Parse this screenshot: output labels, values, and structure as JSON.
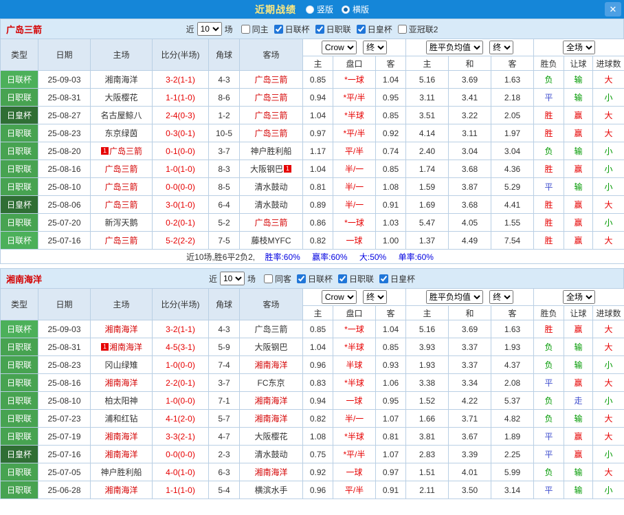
{
  "titlebar": {
    "title": "近期战绩",
    "radio_vertical": "竖版",
    "radio_horizontal": "横版",
    "selected_layout": "横版",
    "close": "✕"
  },
  "colors": {
    "topbar_blue": "#1586d8",
    "title_yellow": "#ffe97f",
    "section_bar_blue": "#d8eaf8",
    "header_blue": "#dce8f4",
    "team_red": "#d40000",
    "result_red": "#e60000",
    "result_green": "#009900",
    "result_blue": "#4150cf",
    "stat_blue": "#0000e0"
  },
  "type_colors": {
    "日联杯": "#4cb05a",
    "日职联": "#47a351",
    "日皇杯": "#2f6e34"
  },
  "sections": [
    {
      "team": "广岛三箭",
      "filter": {
        "near": "近",
        "count": "10",
        "games": "场",
        "checkboxes": [
          {
            "label": "同主",
            "checked": false
          },
          {
            "label": "日联杯",
            "checked": true
          },
          {
            "label": "日职联",
            "checked": true
          },
          {
            "label": "日皇杯",
            "checked": true
          },
          {
            "label": "亚冠联2",
            "checked": false
          }
        ]
      },
      "header": {
        "type": "类型",
        "date": "日期",
        "home": "主场",
        "score": "比分(半场)",
        "corner": "角球",
        "away": "客场",
        "book": "Crow",
        "fin1": "终",
        "euro": "胜平负均值",
        "fin2": "终",
        "scope": "全场",
        "sub": [
          "主",
          "盘口",
          "客",
          "主",
          "和",
          "客",
          "胜负",
          "让球",
          "进球数"
        ]
      },
      "rows": [
        {
          "type": "日联杯",
          "date": "25-09-03",
          "home": "湘南海洋",
          "away": "广岛三箭",
          "away_red": true,
          "score": "3-2(1-1)",
          "corner": "4-3",
          "w1": "0.85",
          "hcp": "*一球",
          "w2": "1.04",
          "o1": "5.16",
          "o2": "3.69",
          "o3": "1.63",
          "r1": "负",
          "r2": "输",
          "r3": "大"
        },
        {
          "type": "日职联",
          "date": "25-08-31",
          "home": "大阪樱花",
          "away": "广岛三箭",
          "away_red": true,
          "score": "1-1(1-0)",
          "corner": "8-6",
          "w1": "0.94",
          "hcp": "*平/半",
          "w2": "0.95",
          "o1": "3.11",
          "o2": "3.41",
          "o3": "2.18",
          "r1": "平",
          "r2": "输",
          "r3": "小"
        },
        {
          "type": "日皇杯",
          "date": "25-08-27",
          "home": "名古屋鲸八",
          "away": "广岛三箭",
          "away_red": true,
          "score": "2-4(0-3)",
          "corner": "1-2",
          "w1": "1.04",
          "hcp": "*半球",
          "w2": "0.85",
          "o1": "3.51",
          "o2": "3.22",
          "o3": "2.05",
          "r1": "胜",
          "r2": "赢",
          "r3": "大"
        },
        {
          "type": "日职联",
          "date": "25-08-23",
          "home": "东京绿茵",
          "away": "广岛三箭",
          "away_red": true,
          "score": "0-3(0-1)",
          "corner": "10-5",
          "w1": "0.97",
          "hcp": "*平/半",
          "w2": "0.92",
          "o1": "4.14",
          "o2": "3.11",
          "o3": "1.97",
          "r1": "胜",
          "r2": "赢",
          "r3": "大"
        },
        {
          "type": "日职联",
          "date": "25-08-20",
          "home": "广岛三箭",
          "home_red": true,
          "home_badge": "1",
          "home_badge_pos": "left",
          "away": "神户胜利船",
          "score": "0-1(0-0)",
          "corner": "3-7",
          "w1": "1.17",
          "hcp": "平/半",
          "w2": "0.74",
          "o1": "2.40",
          "o2": "3.04",
          "o3": "3.04",
          "r1": "负",
          "r2": "输",
          "r3": "小"
        },
        {
          "type": "日职联",
          "date": "25-08-16",
          "home": "广岛三箭",
          "home_red": true,
          "away": "大阪钢巴",
          "away_badge": "1",
          "away_badge_pos": "right",
          "score": "1-0(1-0)",
          "corner": "8-3",
          "w1": "1.04",
          "hcp": "半/一",
          "w2": "0.85",
          "o1": "1.74",
          "o2": "3.68",
          "o3": "4.36",
          "r1": "胜",
          "r2": "赢",
          "r3": "小"
        },
        {
          "type": "日职联",
          "date": "25-08-10",
          "home": "广岛三箭",
          "home_red": true,
          "away": "清水鼓动",
          "score": "0-0(0-0)",
          "corner": "8-5",
          "w1": "0.81",
          "hcp": "半/一",
          "w2": "1.08",
          "o1": "1.59",
          "o2": "3.87",
          "o3": "5.29",
          "r1": "平",
          "r2": "输",
          "r3": "小"
        },
        {
          "type": "日皇杯",
          "date": "25-08-06",
          "home": "广岛三箭",
          "home_red": true,
          "away": "清水鼓动",
          "score": "3-0(1-0)",
          "corner": "6-4",
          "w1": "0.89",
          "hcp": "半/一",
          "w2": "0.91",
          "o1": "1.69",
          "o2": "3.68",
          "o3": "4.41",
          "r1": "胜",
          "r2": "赢",
          "r3": "大"
        },
        {
          "type": "日职联",
          "date": "25-07-20",
          "home": "新泻天鹅",
          "away": "广岛三箭",
          "away_red": true,
          "score": "0-2(0-1)",
          "corner": "5-2",
          "w1": "0.86",
          "hcp": "*一球",
          "w2": "1.03",
          "o1": "5.47",
          "o2": "4.05",
          "o3": "1.55",
          "r1": "胜",
          "r2": "赢",
          "r3": "小"
        },
        {
          "type": "日联杯",
          "date": "25-07-16",
          "home": "广岛三箭",
          "home_red": true,
          "away": "藤枝MYFC",
          "score": "5-2(2-2)",
          "corner": "7-5",
          "w1": "0.82",
          "hcp": "一球",
          "w2": "1.00",
          "o1": "1.37",
          "o2": "4.49",
          "o3": "7.54",
          "r1": "胜",
          "r2": "赢",
          "r3": "大"
        }
      ],
      "summary": {
        "prefix": "近10场,胜6平2负2,",
        "stats": [
          "胜率:60%",
          "赢率:60%",
          "大:50%",
          "单率:60%"
        ]
      }
    },
    {
      "team": "湘南海洋",
      "filter": {
        "near": "近",
        "count": "10",
        "games": "场",
        "checkboxes": [
          {
            "label": "同客",
            "checked": false
          },
          {
            "label": "日联杯",
            "checked": true
          },
          {
            "label": "日职联",
            "checked": true
          },
          {
            "label": "日皇杯",
            "checked": true
          }
        ]
      },
      "header": {
        "type": "类型",
        "date": "日期",
        "home": "主场",
        "score": "比分(半场)",
        "corner": "角球",
        "away": "客场",
        "book": "Crow",
        "fin1": "终",
        "euro": "胜平负均值",
        "fin2": "终",
        "scope": "全场",
        "sub": [
          "主",
          "盘口",
          "客",
          "主",
          "和",
          "客",
          "胜负",
          "让球",
          "进球数"
        ]
      },
      "rows": [
        {
          "type": "日联杯",
          "date": "25-09-03",
          "home": "湘南海洋",
          "home_red": true,
          "away": "广岛三箭",
          "score": "3-2(1-1)",
          "corner": "4-3",
          "w1": "0.85",
          "hcp": "*一球",
          "w2": "1.04",
          "o1": "5.16",
          "o2": "3.69",
          "o3": "1.63",
          "r1": "胜",
          "r2": "赢",
          "r3": "大"
        },
        {
          "type": "日职联",
          "date": "25-08-31",
          "home": "湘南海洋",
          "home_red": true,
          "home_badge": "1",
          "home_badge_pos": "left",
          "away": "大阪钢巴",
          "score": "4-5(3-1)",
          "corner": "5-9",
          "w1": "1.04",
          "hcp": "*半球",
          "w2": "0.85",
          "o1": "3.93",
          "o2": "3.37",
          "o3": "1.93",
          "r1": "负",
          "r2": "输",
          "r3": "大"
        },
        {
          "type": "日职联",
          "date": "25-08-23",
          "home": "冈山绿雉",
          "away": "湘南海洋",
          "away_red": true,
          "score": "1-0(0-0)",
          "corner": "7-4",
          "w1": "0.96",
          "hcp": "半球",
          "w2": "0.93",
          "o1": "1.93",
          "o2": "3.37",
          "o3": "4.37",
          "r1": "负",
          "r2": "输",
          "r3": "小"
        },
        {
          "type": "日职联",
          "date": "25-08-16",
          "home": "湘南海洋",
          "home_red": true,
          "away": "FC东京",
          "score": "2-2(0-1)",
          "corner": "3-7",
          "w1": "0.83",
          "hcp": "*半球",
          "w2": "1.06",
          "o1": "3.38",
          "o2": "3.34",
          "o3": "2.08",
          "r1": "平",
          "r2": "赢",
          "r3": "大"
        },
        {
          "type": "日职联",
          "date": "25-08-10",
          "home": "柏太阳神",
          "away": "湘南海洋",
          "away_red": true,
          "score": "1-0(0-0)",
          "corner": "7-1",
          "w1": "0.94",
          "hcp": "一球",
          "w2": "0.95",
          "o1": "1.52",
          "o2": "4.22",
          "o3": "5.37",
          "r1": "负",
          "r2": "走",
          "r3": "小"
        },
        {
          "type": "日职联",
          "date": "25-07-23",
          "home": "浦和红钻",
          "away": "湘南海洋",
          "away_red": true,
          "score": "4-1(2-0)",
          "corner": "5-7",
          "w1": "0.82",
          "hcp": "半/一",
          "w2": "1.07",
          "o1": "1.66",
          "o2": "3.71",
          "o3": "4.82",
          "r1": "负",
          "r2": "输",
          "r3": "大"
        },
        {
          "type": "日职联",
          "date": "25-07-19",
          "home": "湘南海洋",
          "home_red": true,
          "away": "大阪樱花",
          "score": "3-3(2-1)",
          "corner": "4-7",
          "w1": "1.08",
          "hcp": "*半球",
          "w2": "0.81",
          "o1": "3.81",
          "o2": "3.67",
          "o3": "1.89",
          "r1": "平",
          "r2": "赢",
          "r3": "大"
        },
        {
          "type": "日皇杯",
          "date": "25-07-16",
          "home": "湘南海洋",
          "home_red": true,
          "away": "清水鼓动",
          "score": "0-0(0-0)",
          "corner": "2-3",
          "w1": "0.75",
          "hcp": "*平/半",
          "w2": "1.07",
          "o1": "2.83",
          "o2": "3.39",
          "o3": "2.25",
          "r1": "平",
          "r2": "赢",
          "r3": "小"
        },
        {
          "type": "日职联",
          "date": "25-07-05",
          "home": "神户胜利船",
          "away": "湘南海洋",
          "away_red": true,
          "score": "4-0(1-0)",
          "corner": "6-3",
          "w1": "0.92",
          "hcp": "一球",
          "w2": "0.97",
          "o1": "1.51",
          "o2": "4.01",
          "o3": "5.99",
          "r1": "负",
          "r2": "输",
          "r3": "大"
        },
        {
          "type": "日职联",
          "date": "25-06-28",
          "home": "湘南海洋",
          "home_red": true,
          "away": "横滨水手",
          "score": "1-1(1-0)",
          "corner": "5-4",
          "w1": "0.96",
          "hcp": "平/半",
          "w2": "0.91",
          "o1": "2.11",
          "o2": "3.50",
          "o3": "3.14",
          "r1": "平",
          "r2": "输",
          "r3": "小"
        }
      ]
    }
  ]
}
